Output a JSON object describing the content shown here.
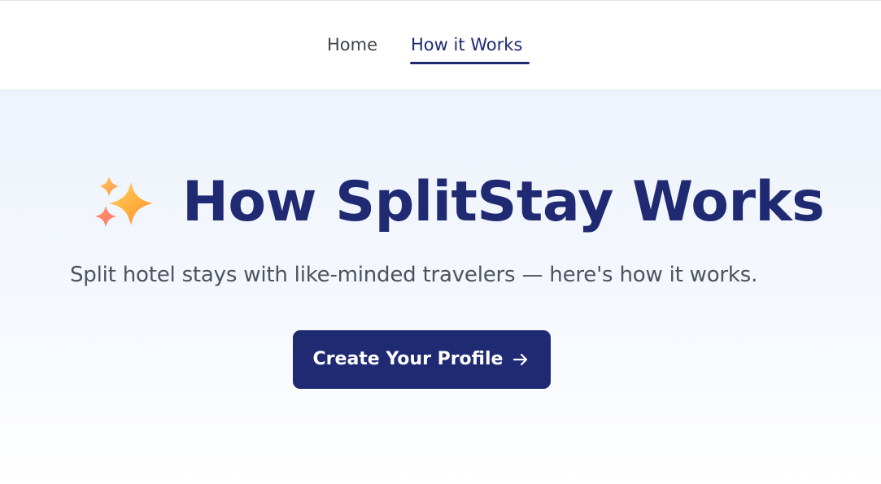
{
  "nav": {
    "items": [
      {
        "label": "Home",
        "active": false
      },
      {
        "label": "How it Works",
        "active": true
      }
    ]
  },
  "hero": {
    "icon": "sparkles-icon",
    "title": "How SplitStay Works",
    "subtitle": "Split hotel stays with like-minded travelers — here's how it works.",
    "cta_label": "Create Your Profile",
    "cta_icon": "arrow-right-icon"
  },
  "colors": {
    "brand": "#1f2a72",
    "nav_text": "#3f434b",
    "subtitle_text": "#4d535d",
    "hero_background_top": "#edf3fc",
    "cta_text": "#ffffff"
  }
}
